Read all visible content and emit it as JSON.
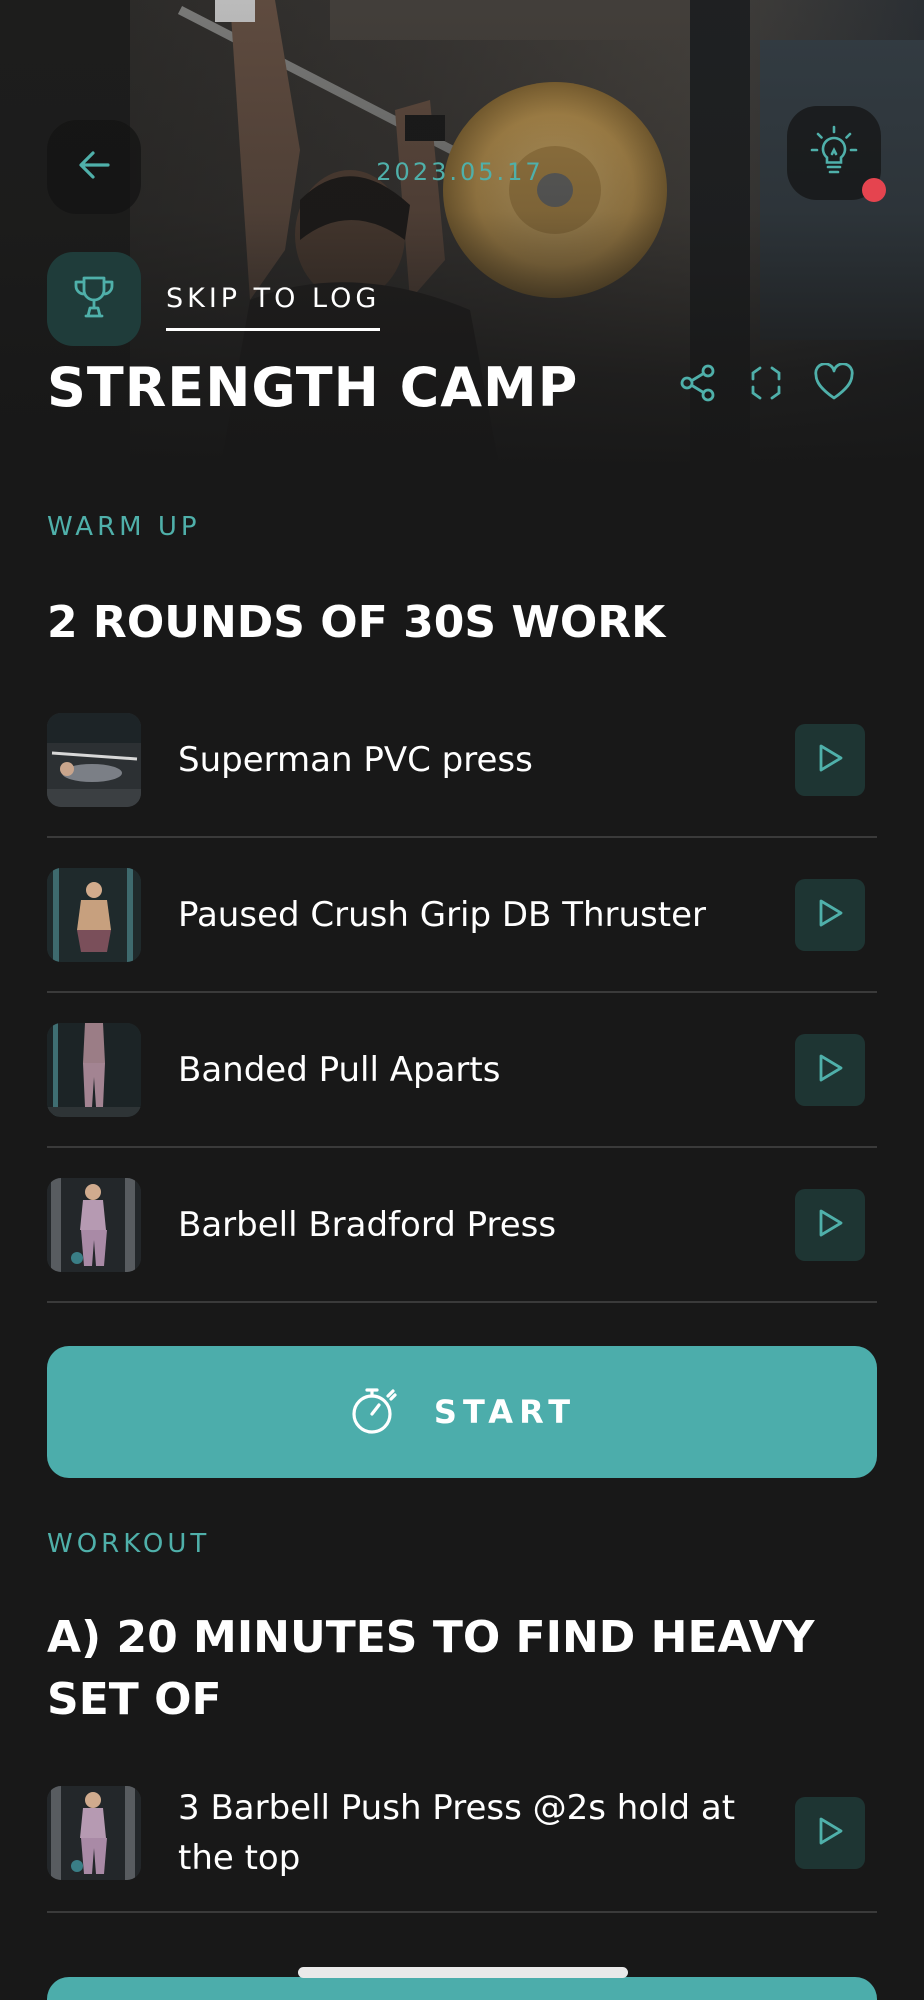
{
  "header": {
    "date": "2023.05.17",
    "skip_label": "SKIP TO LOG",
    "title": "STRENGTH CAMP"
  },
  "warmup": {
    "section_label": "WARM UP",
    "heading": "2 ROUNDS OF 30S WORK",
    "exercises": [
      {
        "name": "Superman PVC press"
      },
      {
        "name": "Paused Crush Grip DB Thruster"
      },
      {
        "name": "Banded Pull Aparts"
      },
      {
        "name": "Barbell Bradford Press"
      }
    ],
    "start_label": "START"
  },
  "workout": {
    "section_label": "WORKOUT",
    "heading": "A) 20 MINUTES TO FIND HEAVY SET OF",
    "exercises": [
      {
        "name": "3 Barbell Push Press @2s hold at the top"
      }
    ]
  },
  "icons": {
    "back": "arrow-left-icon",
    "tip": "lightbulb-icon",
    "trophy": "trophy-icon",
    "share": "share-icon",
    "focus": "focus-frame-icon",
    "favorite": "heart-icon",
    "play": "play-icon",
    "timer": "stopwatch-icon"
  },
  "colors": {
    "accent": "#4cadab",
    "accent_text": "#4fb0aa",
    "background": "#181818",
    "notification_dot": "#e5444f",
    "play_bg": "#1e3533"
  }
}
